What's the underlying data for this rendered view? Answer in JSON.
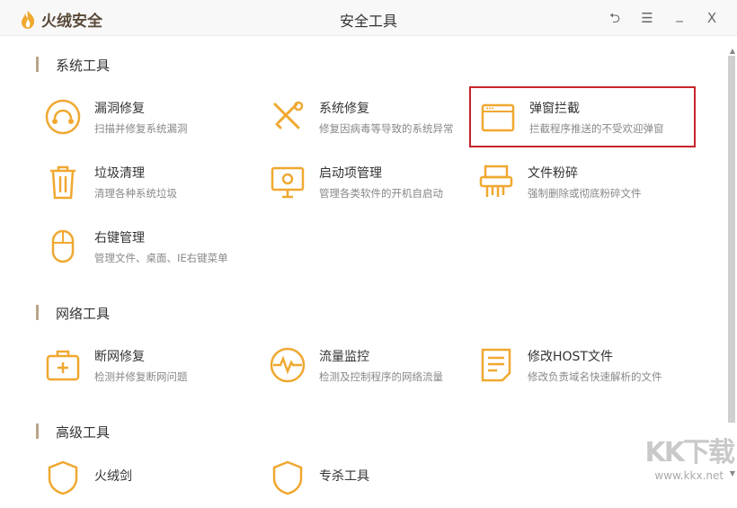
{
  "app": {
    "name": "火绒安全",
    "title": "安全工具"
  },
  "window_buttons": {
    "back": "⮌",
    "menu": "☰",
    "minimize": "_",
    "close": "X"
  },
  "sections": [
    {
      "title": "系统工具",
      "items": [
        {
          "title": "漏洞修复",
          "desc": "扫描并修复系统漏洞",
          "icon": "vulnerability-fix-icon"
        },
        {
          "title": "系统修复",
          "desc": "修复因病毒等导致的系统异常",
          "icon": "wrench-screwdriver-icon"
        },
        {
          "title": "弹窗拦截",
          "desc": "拦截程序推送的不受欢迎弹窗",
          "icon": "popup-window-icon",
          "selected": true
        },
        {
          "title": "垃圾清理",
          "desc": "清理各种系统垃圾",
          "icon": "trash-icon"
        },
        {
          "title": "启动项管理",
          "desc": "管理各类软件的开机自启动",
          "icon": "monitor-power-icon"
        },
        {
          "title": "文件粉碎",
          "desc": "强制删除或彻底粉碎文件",
          "icon": "shredder-icon"
        },
        {
          "title": "右键管理",
          "desc": "管理文件、桌面、IE右键菜单",
          "icon": "mouse-icon"
        }
      ]
    },
    {
      "title": "网络工具",
      "items": [
        {
          "title": "断网修复",
          "desc": "检测并修复断网问题",
          "icon": "medkit-icon"
        },
        {
          "title": "流量监控",
          "desc": "检测及控制程序的网络流量",
          "icon": "pulse-icon"
        },
        {
          "title": "修改HOST文件",
          "desc": "修改负责域名快速解析的文件",
          "icon": "document-icon"
        }
      ]
    },
    {
      "title": "高级工具",
      "items": [
        {
          "title": "火绒剑",
          "desc": "",
          "icon": "shield-icon"
        },
        {
          "title": "专杀工具",
          "desc": "",
          "icon": "shield-icon"
        }
      ]
    }
  ],
  "watermark": {
    "big": "KK下载",
    "small": "www.kkx.net"
  },
  "colors": {
    "accent": "#f0a830",
    "selection": "#c8242b"
  }
}
